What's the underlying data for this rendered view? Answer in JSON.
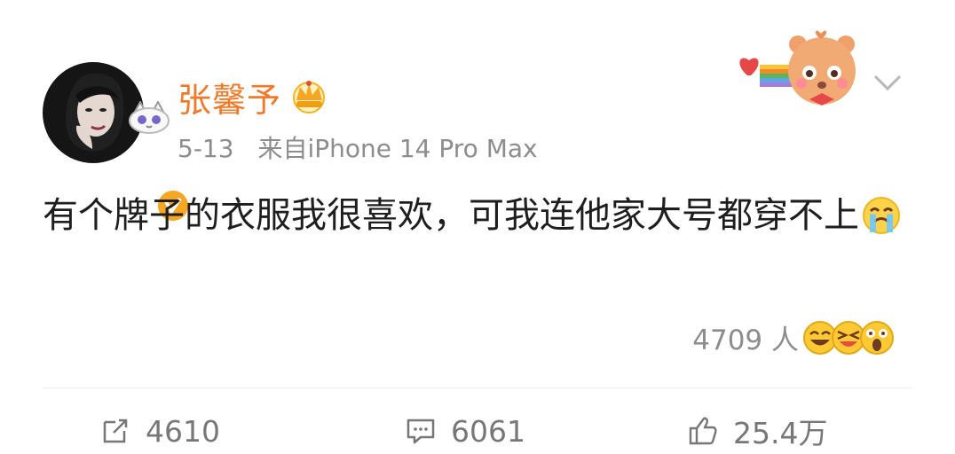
{
  "post": {
    "author": "张馨予",
    "date": "5-13",
    "source": "来自iPhone 14 Pro Max",
    "text": "有个牌子的衣服我很喜欢，可我连他家大号都穿不上",
    "reactions": {
      "count": "4709 人",
      "emojis": [
        "laughing-emoji",
        "grinning-squint-emoji",
        "shocked-emoji"
      ]
    }
  },
  "actions": {
    "repost": {
      "icon": "share-icon",
      "count": "4610"
    },
    "comment": {
      "icon": "comment-icon",
      "count": "6061"
    },
    "like": {
      "icon": "thumbs-up-icon",
      "count": "25.4万"
    }
  },
  "icons": {
    "verified": "verified-badge-icon",
    "member": "crown-icon",
    "menu": "chevron-down-icon",
    "emoji_inline": "crying-emoji"
  },
  "colors": {
    "username": "#f07a2a",
    "meta": "#8d8d8d",
    "action": "#777777",
    "verified": "#f5a623"
  }
}
